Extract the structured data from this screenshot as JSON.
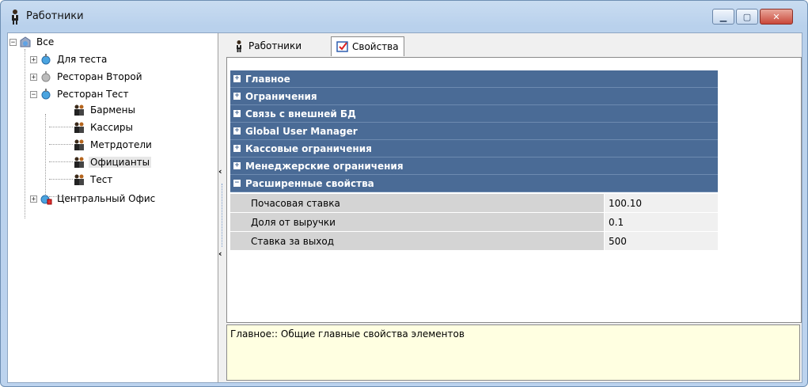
{
  "window": {
    "title": "Работники",
    "icon": "person-icon"
  },
  "tree": {
    "root": {
      "label": "Все",
      "icon": "globe-folder-icon"
    },
    "nodes": [
      {
        "label": "Для теста",
        "icon": "restaurant-node-icon"
      },
      {
        "label": "Ресторан Второй",
        "icon": "restaurant-node-grey-icon"
      },
      {
        "label": "Ресторан Тест",
        "icon": "restaurant-node-icon"
      },
      {
        "label": "Бармены",
        "icon": "group-users-icon"
      },
      {
        "label": "Кассиры",
        "icon": "group-users-icon"
      },
      {
        "label": "Метрдотели",
        "icon": "group-users-icon"
      },
      {
        "label": "Официанты",
        "icon": "group-users-icon"
      },
      {
        "label": "Тест",
        "icon": "group-users-icon"
      },
      {
        "label": "Центральный Офис",
        "icon": "office-node-icon"
      }
    ]
  },
  "tabs": [
    {
      "label": "Работники",
      "icon": "person-icon"
    },
    {
      "label": "Свойства",
      "icon": "properties-icon"
    }
  ],
  "properties": {
    "categories": [
      {
        "label": "Главное",
        "expander": "+"
      },
      {
        "label": "Ограничения",
        "expander": "+"
      },
      {
        "label": "Связь с внешней БД",
        "expander": "+"
      },
      {
        "label": "Global User Manager",
        "expander": "+"
      },
      {
        "label": "Кассовые ограничения",
        "expander": "+"
      },
      {
        "label": "Менеджерские ограничения",
        "expander": "+"
      },
      {
        "label": "Расширенные свойства",
        "expander": "−"
      }
    ],
    "rows": [
      {
        "name": "Почасовая ставка",
        "value": "100.10"
      },
      {
        "name": "Доля от выручки",
        "value": "0.1"
      },
      {
        "name": "Ставка за выход",
        "value": "500"
      }
    ]
  },
  "description": "Главное:: Общие главные свойства элементов",
  "colors": {
    "category_bg": "#4a6b96",
    "description_bg": "#ffffe1",
    "property_name_bg": "#d4d4d4"
  }
}
